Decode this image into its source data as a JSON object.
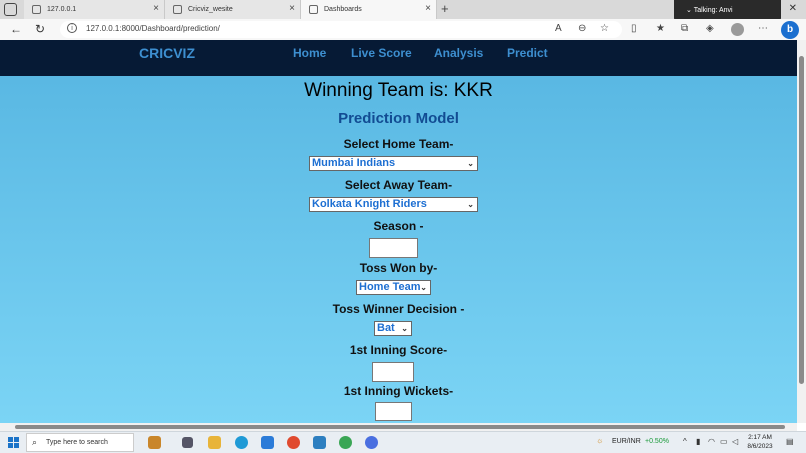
{
  "browser": {
    "tabs": [
      {
        "label": "127.0.0.1",
        "active": false
      },
      {
        "label": "Cricviz_wesite",
        "active": false
      },
      {
        "label": "Dashboards",
        "active": true
      }
    ],
    "notification": "Talking: Anvi",
    "url": "127.0.0.1:8000/Dashboard/prediction/"
  },
  "site": {
    "brand": "CRICVIZ",
    "nav": [
      "Home",
      "Live Score",
      "Analysis",
      "Predict"
    ],
    "colors": {
      "nav_bg": "#061a35",
      "accent": "#3d8fd0",
      "title": "#124c93"
    }
  },
  "page": {
    "winner_text": "Winning Team is: KKR",
    "model_title": "Prediction Model",
    "home_team_label": "Select Home Team-",
    "home_team_value": "Mumbai Indians",
    "away_team_label": "Select  Away Team-",
    "away_team_value": "Kolkata Knight Riders",
    "season_label": "Season -",
    "season_value": "",
    "toss_won_label": "Toss Won by-",
    "toss_won_value": "Home Team",
    "toss_decision_label": "Toss Winner Decision -",
    "toss_decision_value": "Bat",
    "first_inning_score_label": "1st Inning Score-",
    "first_inning_score_value": "",
    "first_inning_wickets_label": "1st Inning Wickets-",
    "first_inning_wickets_value": ""
  },
  "taskbar": {
    "search_placeholder": "Type here to search",
    "ticker_label": "EUR/INR",
    "ticker_change": "+0.50%",
    "time": "2:17 AM",
    "date": "8/6/2023"
  }
}
